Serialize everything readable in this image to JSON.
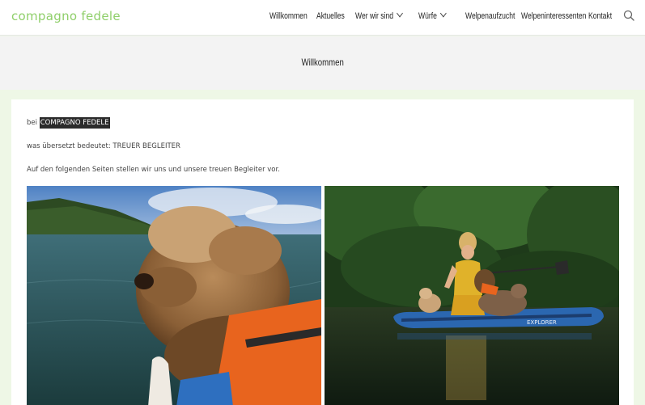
{
  "header": {
    "logo": "compagno fedele",
    "nav": [
      {
        "label": "Willkommen"
      },
      {
        "label": "Aktuelles"
      },
      {
        "label": "Wer wir sind"
      },
      {
        "label": "Würfe"
      },
      {
        "label": "Welpenaufzucht"
      },
      {
        "label": "Welpeninteressenten"
      },
      {
        "label": "Kontakt"
      }
    ],
    "search_icon": "search-icon"
  },
  "page": {
    "title": "Willkommen"
  },
  "content": {
    "line1_prefix": "bei",
    "line1_highlight": "COMPAGNO FEDELE",
    "line2": "was übersetzt bedeutet: TREUER BEGLEITER",
    "line3": "Auf den folgenden Seiten stellen wir uns und unsere treuen Begleiter vor."
  },
  "photos": {
    "left_watermark": "",
    "right_board_text": "EXPLORER"
  },
  "colors": {
    "logo": "#8fcf6a",
    "page_bg": "#eef7e6",
    "title_band": "#f3f3f3"
  }
}
